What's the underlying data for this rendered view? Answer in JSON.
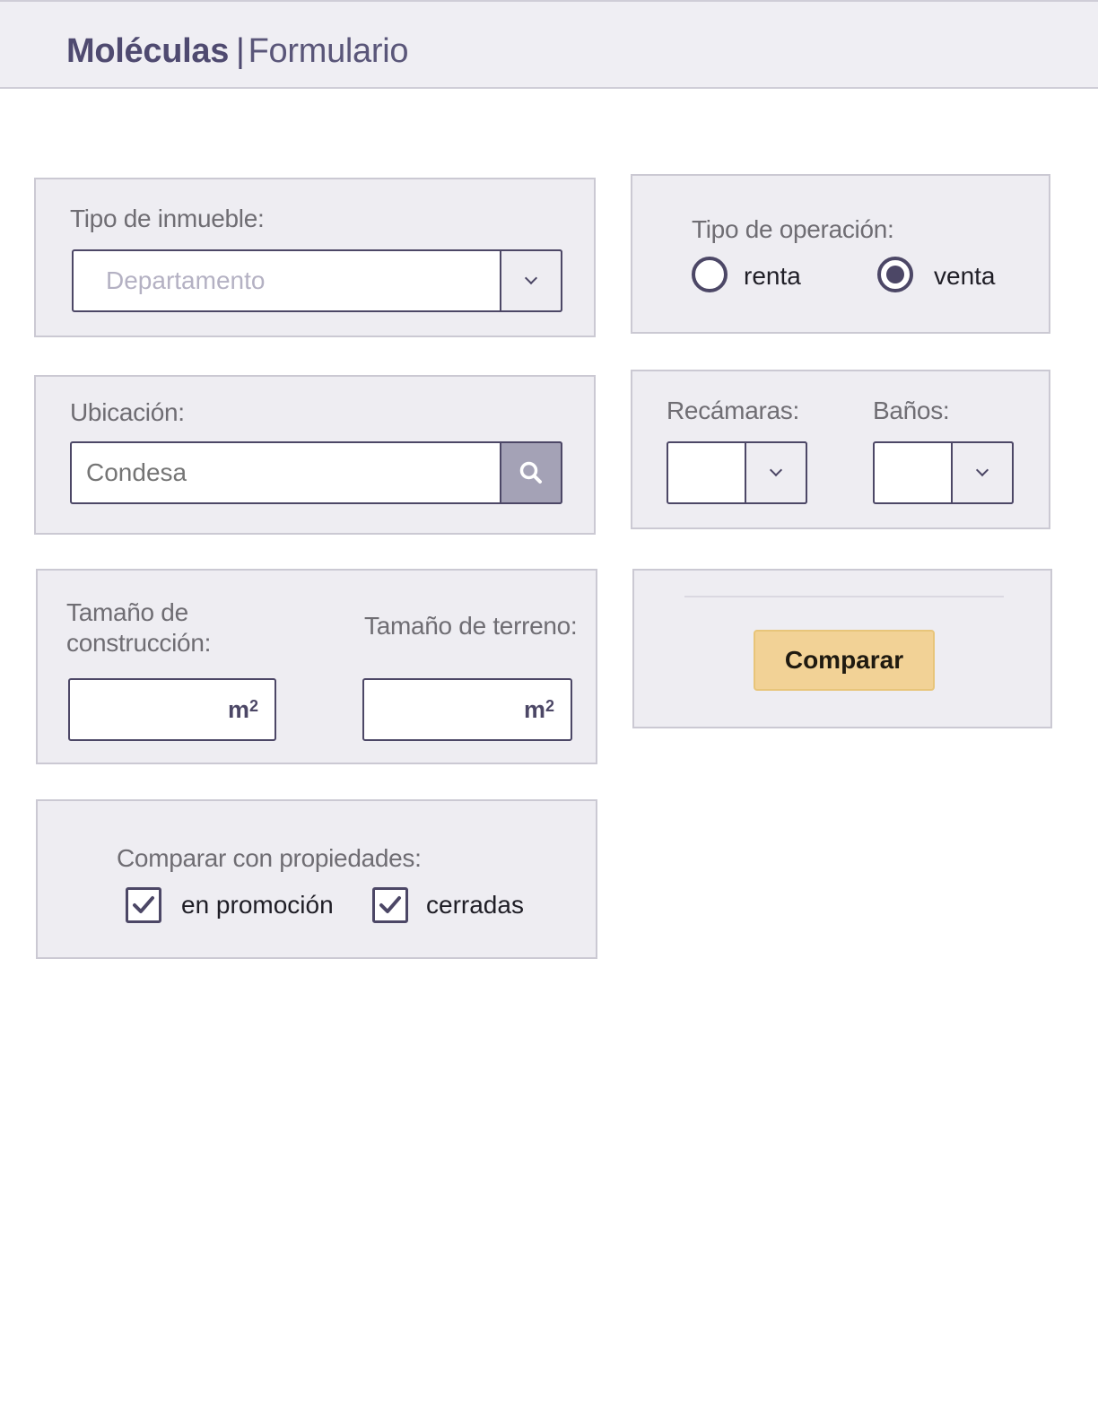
{
  "header": {
    "brand_bold": "Moléculas",
    "separator": "|",
    "brand_sub": "Formulario"
  },
  "property_type": {
    "label": "Tipo de inmueble:",
    "placeholder": "Departamento"
  },
  "operation": {
    "label": "Tipo de operación:",
    "options": [
      {
        "label": "renta",
        "selected": false
      },
      {
        "label": "venta",
        "selected": true
      }
    ]
  },
  "location": {
    "label": "Ubicación:",
    "placeholder": "Condesa"
  },
  "rooms": {
    "bedrooms_label": "Recámaras:",
    "bathrooms_label": "Baños:"
  },
  "sizes": {
    "construction_label": "Tamaño de construcción:",
    "land_label": "Tamaño de terreno:",
    "unit": "m",
    "unit_exp": "2"
  },
  "compare": {
    "button_label": "Comparar"
  },
  "compare_with": {
    "label": "Comparar con propiedades:",
    "options": [
      {
        "label": "en promoción",
        "checked": true
      },
      {
        "label": "cerradas",
        "checked": true
      }
    ]
  },
  "colors": {
    "accent": "#4c4766",
    "panel_bg": "#eeedf2",
    "button_bg": "#f2d296"
  }
}
